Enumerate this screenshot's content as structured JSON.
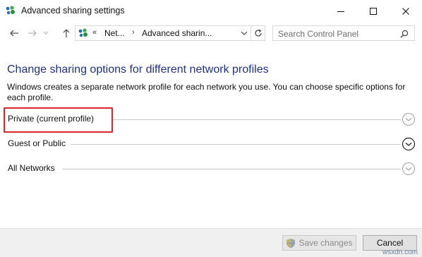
{
  "window": {
    "title": "Advanced sharing settings"
  },
  "nav": {
    "breadcrumb_prefix": "«",
    "breadcrumbs": [
      "Net...",
      "Advanced sharin..."
    ],
    "breadcrumb_separator": "›",
    "search_placeholder": "Search Control Panel"
  },
  "content": {
    "heading": "Change sharing options for different network profiles",
    "description": "Windows creates a separate network profile for each network you use. You can choose specific options for each profile.",
    "sections": [
      {
        "label": "Private (current profile)",
        "chevron_style": "light"
      },
      {
        "label": "Guest or Public",
        "chevron_style": "dark"
      },
      {
        "label": "All Networks",
        "chevron_style": "light"
      }
    ]
  },
  "footer": {
    "save_label": "Save changes",
    "cancel_label": "Cancel"
  },
  "watermark": "wsxdn.com",
  "colors": {
    "heading": "#1e3287",
    "highlight_border": "#d9262b",
    "footer_bg": "#f0f0f0"
  }
}
